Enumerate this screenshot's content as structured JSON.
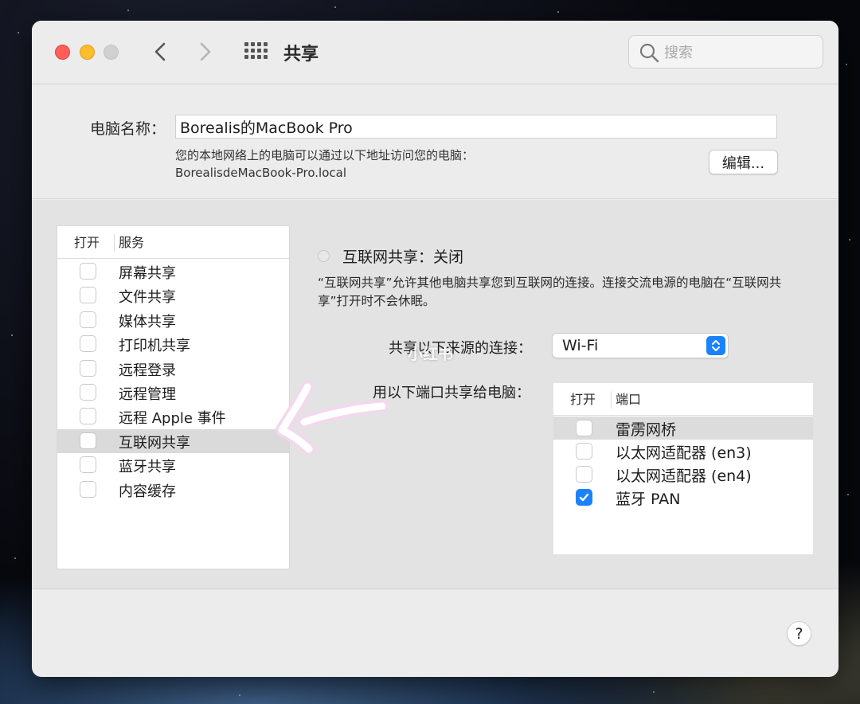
{
  "window": {
    "title": "共享"
  },
  "search": {
    "placeholder": "搜索"
  },
  "computer_name": {
    "label": "电脑名称：",
    "value": "Borealis的MacBook Pro",
    "address_line1": "您的本地网络上的电脑可以通过以下地址访问您的电脑：",
    "address_line2": "BorealisdeMacBook-Pro.local",
    "edit_label": "编辑..."
  },
  "services": {
    "col_on": "打开",
    "col_service": "服务",
    "items": [
      {
        "label": "屏幕共享",
        "checked": false
      },
      {
        "label": "文件共享",
        "checked": false
      },
      {
        "label": "媒体共享",
        "checked": false
      },
      {
        "label": "打印机共享",
        "checked": false
      },
      {
        "label": "远程登录",
        "checked": false
      },
      {
        "label": "远程管理",
        "checked": false
      },
      {
        "label": "远程 Apple 事件",
        "checked": false
      },
      {
        "label": "互联网共享",
        "checked": false,
        "selected": true
      },
      {
        "label": "蓝牙共享",
        "checked": false
      },
      {
        "label": "内容缓存",
        "checked": false
      }
    ]
  },
  "internet_sharing": {
    "status": "互联网共享：关闭",
    "description": "“互联网共享”允许其他电脑共享您到互联网的连接。连接交流电源的电脑在“互联网共享”打开时不会休眠。",
    "from_label": "共享以下来源的连接：",
    "from_value": "Wi-Fi",
    "to_label": "用以下端口共享给电脑：",
    "ports_col_on": "打开",
    "ports_col_port": "端口",
    "ports": [
      {
        "label": "雷雳网桥",
        "checked": false,
        "selected": true
      },
      {
        "label": "以太网适配器 (en3)",
        "checked": false
      },
      {
        "label": "以太网适配器 (en4)",
        "checked": false
      },
      {
        "label": "蓝牙 PAN",
        "checked": true
      }
    ]
  },
  "watermark": "小红书",
  "help_label": "?",
  "colors": {
    "accent": "#1a82fb",
    "selection": "#dadada"
  },
  "icons": [
    "close-light",
    "minimize-light",
    "zoom-light",
    "chevron-left-icon",
    "chevron-right-icon",
    "grid-icon",
    "search-icon",
    "checkmark-icon",
    "stepper-icon",
    "hand-drawn-arrow"
  ]
}
